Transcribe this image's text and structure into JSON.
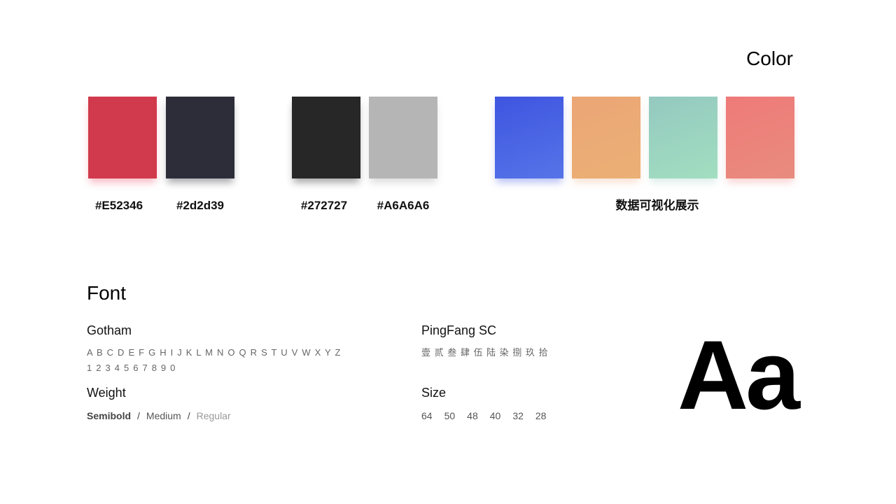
{
  "color_section": {
    "title": "Color",
    "swatches": [
      {
        "label": "#E52346",
        "color": "#d13a4c",
        "shadow": "rgba(229,35,70,0.30)"
      },
      {
        "label": "#2d2d39",
        "color": "#2d2d39",
        "shadow": "rgba(45,45,57,0.40)"
      },
      {
        "label": "#272727",
        "color": "#272727",
        "shadow": "rgba(39,39,39,0.40)"
      },
      {
        "label": "#A6A6A6",
        "color": "#b5b5b5",
        "shadow": "rgba(120,120,120,0.25)"
      }
    ],
    "data_viz": {
      "label": "数据可视化展示",
      "swatches": [
        {
          "gradient_from": "#3e55e0",
          "gradient_to": "#5674e8",
          "shadow": "rgba(62,85,224,0.35)"
        },
        {
          "gradient_from": "#eba676",
          "gradient_to": "#ebb075",
          "shadow": "rgba(235,166,118,0.30)"
        },
        {
          "gradient_from": "#94c9c0",
          "gradient_to": "#a2dec0",
          "shadow": "rgba(148,201,192,0.30)"
        },
        {
          "gradient_from": "#ef7a78",
          "gradient_to": "#e88c7e",
          "shadow": "rgba(239,122,120,0.30)"
        }
      ]
    }
  },
  "font_section": {
    "title": "Font",
    "gotham": {
      "name": "Gotham",
      "alphabet": "A B C D E F G H I J K L M N O Q R S T U V W X Y Z",
      "digits": "1 2 3 4 5 6 7 8 9 0"
    },
    "pingfang": {
      "name": "PingFang SC",
      "sample": "壹 贰 叁 肆 伍 陆 染 捌 玖 拾"
    },
    "weight": {
      "title": "Weight",
      "semibold": "Semibold",
      "medium": "Medium",
      "regular": "Regular",
      "separator": "/"
    },
    "size": {
      "title": "Size",
      "values": [
        "64",
        "50",
        "48",
        "40",
        "32",
        "28"
      ]
    },
    "sample_glyph": "Aa"
  }
}
